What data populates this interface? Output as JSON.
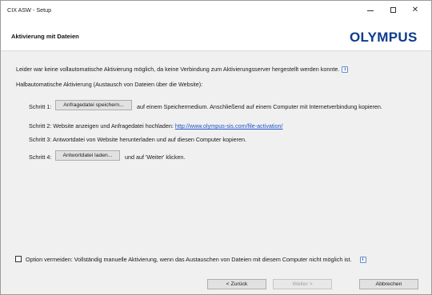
{
  "window": {
    "title": "CIX ASW - Setup",
    "minimize_label": "–",
    "close_label": "✕"
  },
  "header": {
    "title": "Aktivierung mit Dateien",
    "logo_text": "OLYMPUS",
    "logo_color": "#0c3c8c"
  },
  "body": {
    "info_text": "Leider war keine vollautomatische Aktivierung möglich, da keine Verbindung zum Aktivierungsserver hergestellt werden konnte.",
    "info_icon": "i",
    "section_heading": "Halbautomatische Aktivierung (Austausch von Dateien über die Website):",
    "steps": [
      {
        "label": "Schritt 1:",
        "button": "Anfragedatei speichern...",
        "text": "auf einem Speichermedium. Anschließend auf einem Computer mit Internetverbindung kopieren."
      },
      {
        "label": "Schritt 2:",
        "text": "Website anzeigen und Anfragedatei hochladen:",
        "link": "http://www.olympus-sis.com/file-activation/"
      },
      {
        "label": "Schritt 3:",
        "text": "Antwortdatei von Website herunterladen und auf diesen Computer kopieren."
      },
      {
        "label": "Schritt 4:",
        "button": "Antwortdatei laden...",
        "text": "und auf 'Weiter' klicken."
      }
    ],
    "option_text": "Option vermeiden: Vollständig manuelle Aktivierung, wenn das Austauschen von Dateien mit diesem Computer nicht möglich ist.",
    "option_checked": false
  },
  "footer": {
    "back_label": "< Zurück",
    "next_label": "Weiter >",
    "cancel_label": "Abbrechen"
  }
}
